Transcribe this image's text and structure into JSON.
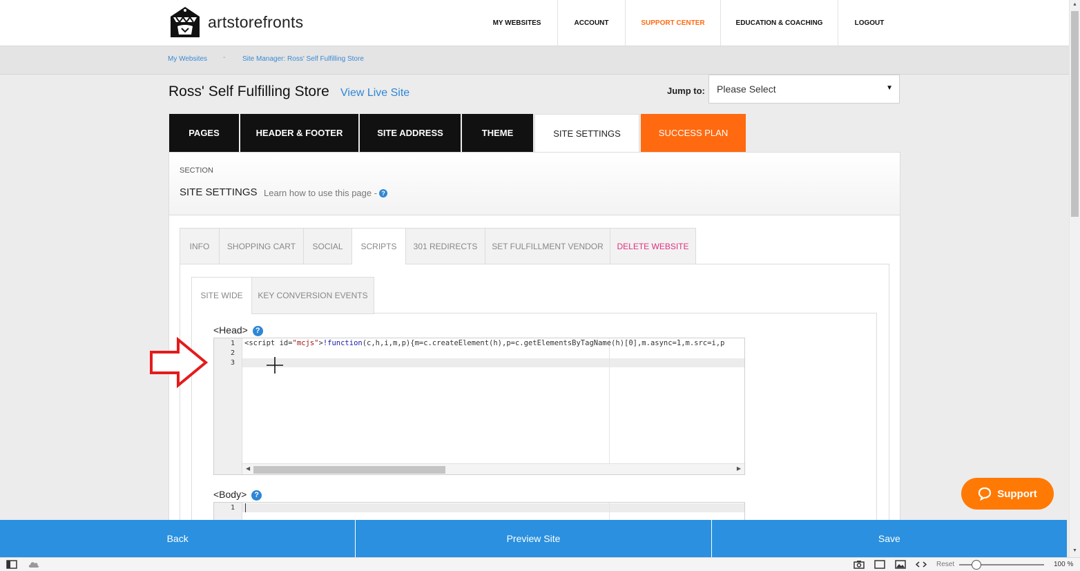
{
  "brand": {
    "name_prefix": "art",
    "name_suffix": "storefronts"
  },
  "nav": [
    {
      "label": "MY WEBSITES",
      "color": "#111111"
    },
    {
      "label": "ACCOUNT",
      "color": "#111111"
    },
    {
      "label": "SUPPORT CENTER",
      "color": "#ff6a10"
    },
    {
      "label": "EDUCATION & COACHING",
      "color": "#111111"
    },
    {
      "label": "LOGOUT",
      "color": "#111111"
    }
  ],
  "breadcrumb": {
    "items": [
      "My Websites",
      "Site Manager: Ross' Self Fulfilling Store"
    ],
    "separator": "-"
  },
  "header": {
    "title": "Ross' Self Fulfilling Store",
    "view_live": "View Live Site",
    "jump_label": "Jump to:",
    "jump_value": "Please Select"
  },
  "main_tabs": [
    "PAGES",
    "HEADER & FOOTER",
    "SITE ADDRESS",
    "THEME",
    "SITE SETTINGS",
    "SUCCESS PLAN"
  ],
  "section": {
    "kicker": "SECTION",
    "title": "SITE SETTINGS",
    "help": "Learn how to use this page -"
  },
  "sub_tabs": [
    "INFO",
    "SHOPPING CART",
    "SOCIAL",
    "SCRIPTS",
    "301 REDIRECTS",
    "SET FULFILLMENT VENDOR",
    "DELETE WEBSITE"
  ],
  "inner_tabs": [
    "SITE WIDE",
    "KEY CONVERSION EVENTS"
  ],
  "head_field": {
    "label": "<Head>",
    "line_numbers": [
      "1",
      "2",
      "3"
    ],
    "line1": {
      "tag_open": "<script id=",
      "id_value": "\"mcjs\"",
      "gt": ">",
      "bang": "!",
      "kw": "function",
      "rest": "(c,h,i,m,p){m=c.createElement(h),p=c.getElementsByTagName(h)[0],m.async=1,m.src=i,p"
    }
  },
  "body_field": {
    "label": "<Body>",
    "line_numbers": [
      "1"
    ]
  },
  "support_label": "Support",
  "actions": {
    "back": "Back",
    "preview": "Preview Site",
    "save": "Save"
  },
  "statusbar": {
    "reset": "Reset",
    "zoom": "100 %"
  },
  "colors": {
    "accent_blue": "#2a90df",
    "accent_orange": "#ff6a10",
    "danger_pink": "#e0307e"
  }
}
